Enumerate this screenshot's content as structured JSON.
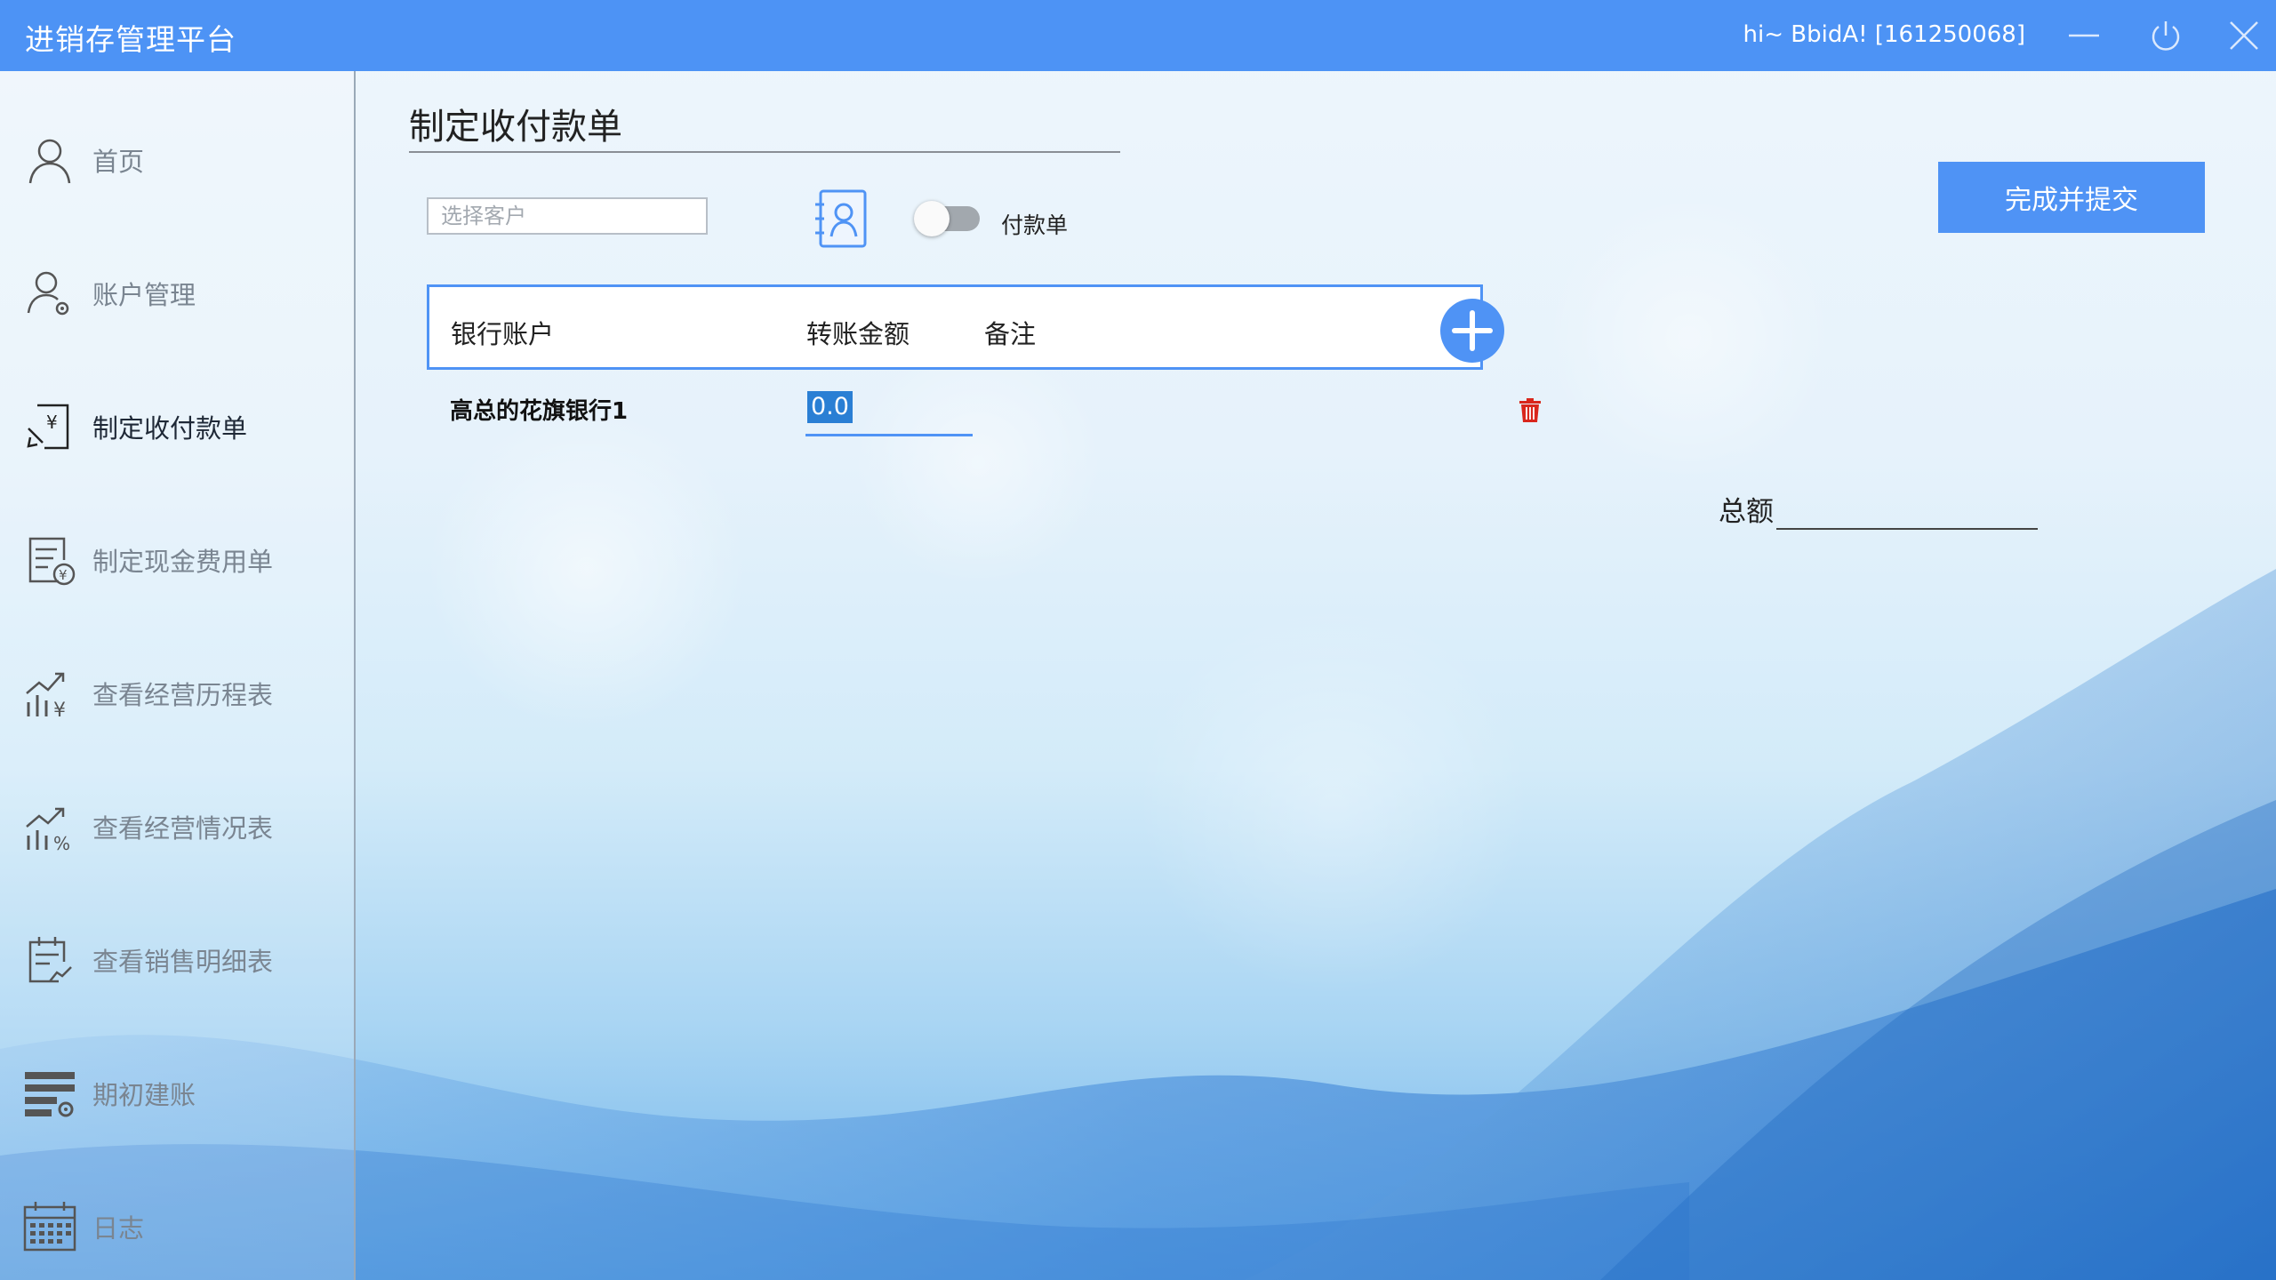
{
  "app": {
    "title": "进销存管理平台",
    "user_info": "hi~ BbidA! [161250068]",
    "colors": {
      "accent": "#4f93f5",
      "title_bar": "#4d93f5",
      "delete": "#d9261c"
    }
  },
  "window_controls": {
    "minimize_icon": "minimize-icon",
    "power_icon": "power-icon",
    "close_icon": "close-icon"
  },
  "sidebar": {
    "items": [
      {
        "label": "首页",
        "icon": "user-icon"
      },
      {
        "label": "账户管理",
        "icon": "user-settings-icon"
      },
      {
        "label": "制定收付款单",
        "icon": "yuan-exchange-icon"
      },
      {
        "label": "制定现金费用单",
        "icon": "receipt-yuan-icon"
      },
      {
        "label": "查看经营历程表",
        "icon": "chart-yuan-icon"
      },
      {
        "label": "查看经营情况表",
        "icon": "chart-growth-icon"
      },
      {
        "label": "查看销售明细表",
        "icon": "clipboard-chart-icon"
      },
      {
        "label": "期初建账",
        "icon": "list-settings-icon"
      },
      {
        "label": "日志",
        "icon": "calendar-icon"
      }
    ],
    "active_index": 2
  },
  "main": {
    "page_title": "制定收付款单",
    "customer_placeholder": "选择客户",
    "toggle_label": "付款单",
    "submit_label": "完成并提交",
    "table": {
      "headers": [
        "银行账户",
        "转账金额",
        "备注"
      ],
      "rows": [
        {
          "bank": "高总的花旗银行1",
          "amount": "0.0",
          "note": ""
        }
      ]
    },
    "total_label": "总额",
    "total_value": ""
  }
}
